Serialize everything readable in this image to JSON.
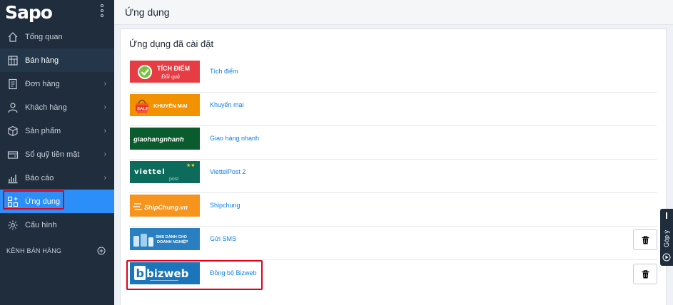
{
  "sidebar": {
    "logo": "Sapo",
    "items": [
      {
        "label": "Tổng quan",
        "icon": "home-icon",
        "has_children": false
      },
      {
        "label": "Bán hàng",
        "icon": "store-icon",
        "has_children": false
      },
      {
        "label": "Đơn hàng",
        "icon": "order-icon",
        "has_children": true
      },
      {
        "label": "Khách hàng",
        "icon": "user-icon",
        "has_children": true
      },
      {
        "label": "Sản phẩm",
        "icon": "box-icon",
        "has_children": true
      },
      {
        "label": "Sổ quỹ tiền mặt",
        "icon": "wallet-icon",
        "has_children": true
      },
      {
        "label": "Báo cáo",
        "icon": "chart-icon",
        "has_children": true
      },
      {
        "label": "Ứng dụng",
        "icon": "apps-icon",
        "has_children": false
      },
      {
        "label": "Cấu hình",
        "icon": "gear-icon",
        "has_children": false
      }
    ],
    "channel_label": "KÊNH BÁN HÀNG"
  },
  "header": {
    "title": "Ứng dụng"
  },
  "main": {
    "section_title": "Ứng dụng đã cài đặt",
    "apps": [
      {
        "name": "Tích điểm",
        "logo_text": "TÍCH ĐIỂM",
        "logo_sub": "Đổi quà",
        "has_delete": false
      },
      {
        "name": "Khuyến mại",
        "logo_text": "KHUYẾN MẠI",
        "logo_badge": "SALE",
        "has_delete": false
      },
      {
        "name": "Giao hàng nhanh",
        "logo_text": "giaohangnhanh",
        "has_delete": false
      },
      {
        "name": "ViettelPost 2",
        "logo_text": "viettel",
        "logo_sub": "post",
        "has_delete": false
      },
      {
        "name": "Shipchung",
        "logo_text": "ShipChung.vn",
        "has_delete": false
      },
      {
        "name": "Gửi SMS",
        "logo_text": "SMS DÀNH CHO DOANH NGHIỆP",
        "has_delete": true
      },
      {
        "name": "Đồng bộ Bizweb",
        "logo_text": "bizweb",
        "has_delete": true
      }
    ]
  },
  "feedback": {
    "label": "Góp ý"
  },
  "colors": {
    "sidebar_bg": "#1f2d3d",
    "active_item": "#2c8ef8",
    "link": "#0f7ee8",
    "highlight": "#e3001b"
  }
}
